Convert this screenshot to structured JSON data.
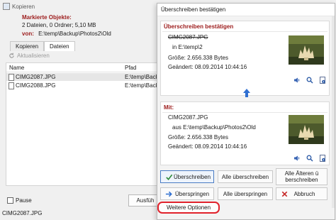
{
  "background_window": {
    "title": "Kopieren",
    "marked_label": "Markierte Objekte:",
    "counts": "2 Dateien, 0 Ordner;   5,10 MB",
    "from_label": "von:",
    "from_path": "E:\\temp\\Backup\\Photos2\\Old",
    "tabs": [
      "Kopieren",
      "Dateien"
    ],
    "refresh_label": "Aktualisieren",
    "columns": {
      "name": "Name",
      "path": "Pfad"
    },
    "rows": [
      {
        "name": "CIMG2087.JPG",
        "path": "E:\\temp\\Backu"
      },
      {
        "name": "CIMG2088.JPG",
        "path": "E:\\temp\\Backu"
      }
    ],
    "pause_label": "Pause",
    "execute_button": "Ausfüh",
    "status_text": "CIMG2087.JPG"
  },
  "dialog": {
    "title": "Überschreiben bestätigen",
    "existing": {
      "heading": "Überschreiben bestätigen",
      "filename": "CIMG2087.JPG",
      "location": "in E:\\temp\\2",
      "size": "Größe: 2.656.338 Bytes",
      "modified": "Geändert: 08.09.2014 10:44:16"
    },
    "incoming": {
      "heading": "Mit:",
      "filename": "CIMG2087.JPG",
      "location": "aus E:\\temp\\Backup\\Photos2\\Old",
      "size": "Größe: 2.656.338 Bytes",
      "modified": "Geändert: 08.09.2014 10:44:16"
    },
    "buttons": {
      "overwrite": "Überschreiben",
      "overwrite_all": "Alle überschreiben",
      "overwrite_older_1": "Alle Älteren ü",
      "overwrite_older_2": "berschreiben",
      "skip": "Überspringen",
      "skip_all": "Alle überspringen",
      "cancel": "Abbruch",
      "more_options": "Weitere Optionen"
    }
  },
  "colors": {
    "accent_red": "#9c1b1b",
    "highlight_red": "#e0212b",
    "arrow_blue": "#2f6fd1",
    "check_green": "#2e8b3a"
  }
}
